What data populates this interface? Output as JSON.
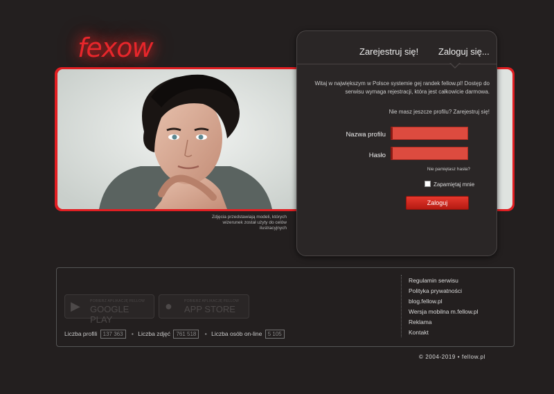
{
  "logo": {
    "text": "fexow"
  },
  "photo_caption": "Zdjęcia przedstawiają modeli, których wizerunek został użyty do celów ilustracyjnych",
  "tabs": {
    "register": "Zarejestruj się!",
    "login": "Zaloguj się..."
  },
  "welcome": "Witaj w największym w Polsce systemie gej randek fellow.pl! Dostęp do serwisu wymaga rejestracji, która jest całkowicie darmowa.",
  "no_profile": "Nie masz jeszcze profilu? Zarejestruj się!",
  "form": {
    "username_label": "Nazwa profilu",
    "username_value": "",
    "password_label": "Hasło",
    "password_value": "",
    "forgot": "Nie pamiętasz hasła?",
    "remember": "Zapamiętaj mnie",
    "remember_checked": false,
    "submit": "Zaloguj"
  },
  "stores": {
    "google": {
      "small": "POBIERZ APLIKACJĘ FELLOW",
      "big": "GOOGLE PLAY",
      "icon": "play-icon"
    },
    "apple": {
      "small": "POBIERZ APLIKACJĘ FELLOW",
      "big": "APP STORE",
      "icon": "apple-icon"
    }
  },
  "stats": {
    "profiles_label": "Liczba profili",
    "profiles_value": "137 363",
    "photos_label": "Liczba zdjęć",
    "photos_value": "761 518",
    "online_label": "Liczba osób on-line",
    "online_value": "5 105"
  },
  "footer_links": [
    "Regulamin serwisu",
    "Polityka prywatności",
    "blog.fellow.pl",
    "Wersja mobilna m.fellow.pl",
    "Reklama",
    "Kontakt"
  ],
  "copyright": "© 2004-2019 • fellow.pl",
  "colors": {
    "accent": "#e11e22",
    "background": "#231f1f",
    "panel": "#2a2626"
  }
}
